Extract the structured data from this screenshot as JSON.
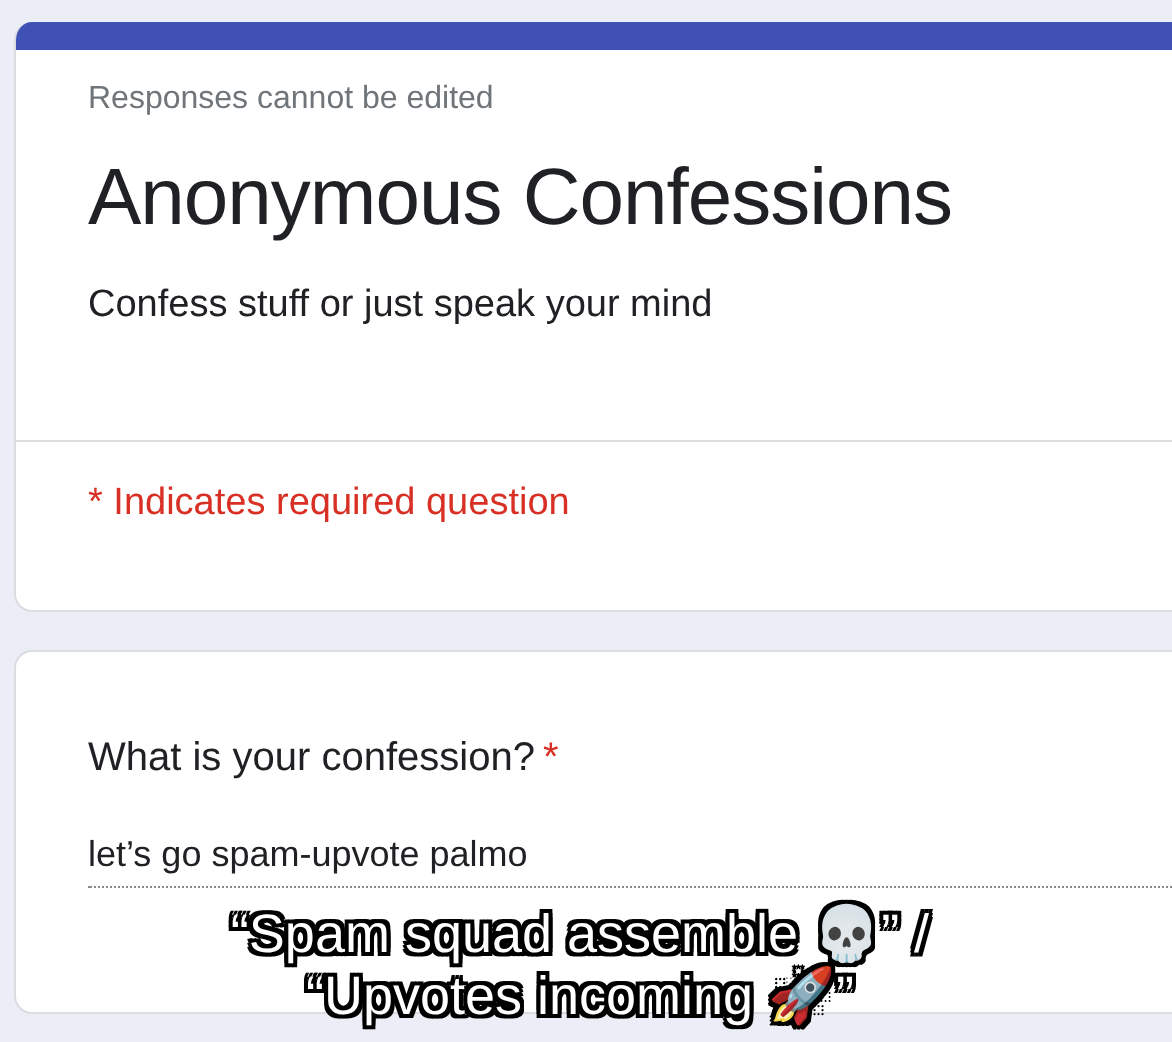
{
  "form_header": {
    "notice": "Responses cannot be edited",
    "title": "Anonymous Confessions",
    "description": "Confess stuff or just speak your mind",
    "required_note": "* Indicates required question"
  },
  "question": {
    "label": "What is your confession?",
    "required": true,
    "required_mark": "*",
    "answer": "let’s go spam-upvote palmo"
  },
  "caption": "“Spam squad assemble 💀” / “Upvotes incoming 🚀”"
}
